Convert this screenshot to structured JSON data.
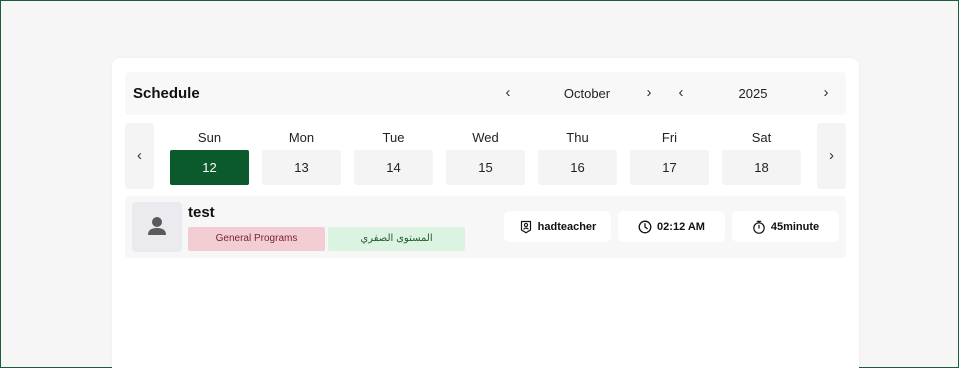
{
  "schedule": {
    "title": "Schedule",
    "month": "October",
    "year": "2025",
    "prev_glyph": "‹",
    "next_glyph": "›"
  },
  "week": {
    "days": [
      {
        "name": "Sun",
        "num": "12"
      },
      {
        "name": "Mon",
        "num": "13"
      },
      {
        "name": "Tue",
        "num": "14"
      },
      {
        "name": "Wed",
        "num": "15"
      },
      {
        "name": "Thu",
        "num": "16"
      },
      {
        "name": "Fri",
        "num": "17"
      },
      {
        "name": "Sat",
        "num": "18"
      }
    ],
    "selected_index": 0
  },
  "session": {
    "title": "test",
    "tags": [
      "General Programs",
      "المستوى الصفري"
    ],
    "teacher": "hadteacher",
    "time": "02:12 AM",
    "duration": "45minute",
    "icons": [
      "person-badge-icon",
      "clock-icon",
      "stopwatch-icon",
      "user-icon"
    ]
  },
  "colors": {
    "selected_day": "#0b5a2e",
    "tag_red_bg": "#f2cdd3",
    "tag_green_bg": "#ddf3e2",
    "frame_border": "#1e5c3a"
  }
}
